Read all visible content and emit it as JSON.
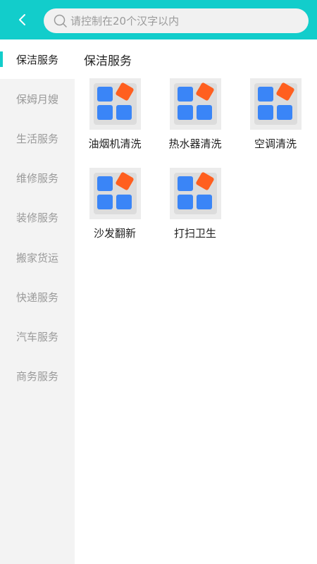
{
  "header": {
    "search_placeholder": "请控制在20个汉字以内",
    "accent_color": "#12cdcb",
    "back_icon": "chevron-left-icon",
    "search_icon": "search-icon"
  },
  "sidebar": {
    "items": [
      {
        "label": "保洁服务",
        "active": true
      },
      {
        "label": "保姆月嫂",
        "active": false
      },
      {
        "label": "生活服务",
        "active": false
      },
      {
        "label": "维修服务",
        "active": false
      },
      {
        "label": "装修服务",
        "active": false
      },
      {
        "label": "搬家货运",
        "active": false
      },
      {
        "label": "快递服务",
        "active": false
      },
      {
        "label": "汽车服务",
        "active": false
      },
      {
        "label": "商务服务",
        "active": false
      }
    ]
  },
  "main": {
    "title": "保洁服务",
    "services": [
      {
        "label": "油烟机清洗",
        "icon": "app-grid-icon"
      },
      {
        "label": "热水器清洗",
        "icon": "app-grid-icon"
      },
      {
        "label": "空调清洗",
        "icon": "app-grid-icon"
      },
      {
        "label": "沙发翻新",
        "icon": "app-grid-icon"
      },
      {
        "label": "打扫卫生",
        "icon": "app-grid-icon"
      }
    ]
  }
}
